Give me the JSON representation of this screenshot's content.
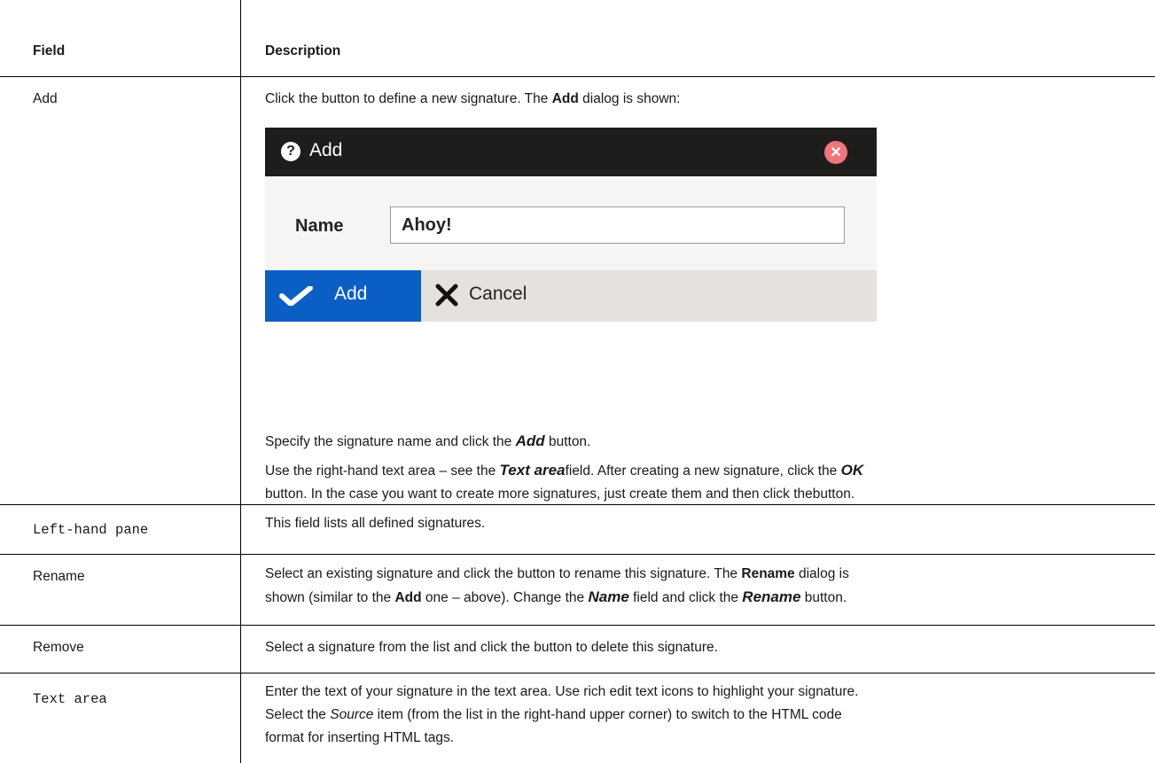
{
  "header": {
    "field": "Field",
    "description": "Description"
  },
  "rows": {
    "add": {
      "field": "Add",
      "line1_a": "Click the button to define a new signature. The ",
      "line1_b": "Add",
      "line1_c": " dialog is shown:",
      "dialog": {
        "title": "Add",
        "name_label": "Name",
        "name_value": "Ahoy!",
        "ok_label": "Add",
        "cancel_label": "Cancel",
        "help_icon": "question-circle-icon",
        "close_icon": "close-circle-icon",
        "accent": "#0b5fc4"
      },
      "p2_a": "Specify the signature name and click the ",
      "p2_b": "Add",
      "p2_c": " button.",
      "p3_a": "Use the right-hand text area – see the ",
      "p3_b": "Text area",
      "p3_c": "field. After creating a new signature, click the ",
      "p3_d": "OK",
      "p3_e": "button. In the case you want to create more signatures, just create them and then click thebutton."
    },
    "left_pane": {
      "field": "Left-hand pane",
      "text": "This field lists all defined signatures."
    },
    "rename": {
      "field": "Rename",
      "l1_a": "Select an existing signature and click the button to rename this signature. The ",
      "l1_b": "Rename",
      "l1_c": " dialog is",
      "l2_a": "shown (similar to the ",
      "l2_b": "Add",
      "l2_c": " one – above). Change the ",
      "l2_d": "Name",
      "l2_e": " field and click the ",
      "l2_f": "Rename",
      "l2_g": " button."
    },
    "remove": {
      "field": "Remove",
      "text": "Select a signature from the list and click the button to delete this signature."
    },
    "text_area": {
      "field": "Text area",
      "l1": "Enter the text of your signature in the text area. Use rich edit text icons to highlight your signature.",
      "l2_a": "Select the ",
      "l2_b": "Source",
      "l2_c": " item (from the list in the right-hand upper corner) to switch to the HTML code",
      "l3": "format for inserting HTML tags."
    }
  }
}
